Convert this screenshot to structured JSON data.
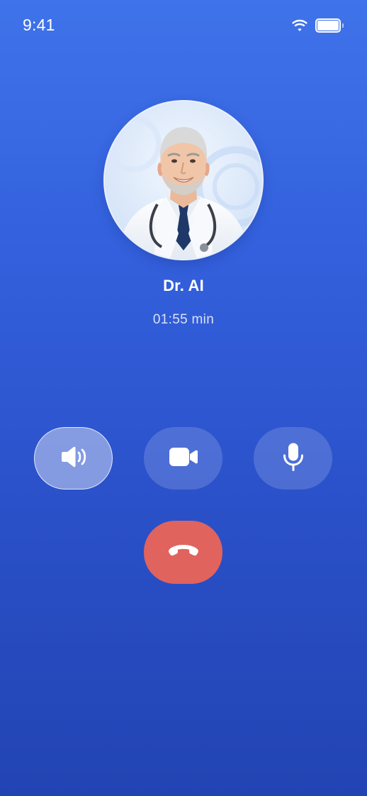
{
  "status_bar": {
    "time": "9:41",
    "wifi_icon": "wifi-icon",
    "battery_icon": "battery-icon",
    "battery_level": 1.0
  },
  "call": {
    "caller_name": "Dr. AI",
    "duration": "01:55 min",
    "avatar_icon": "doctor-avatar"
  },
  "controls": [
    {
      "name": "speaker",
      "icon": "speaker-icon",
      "active": true
    },
    {
      "name": "video",
      "icon": "video-camera-icon",
      "active": false
    },
    {
      "name": "microphone",
      "icon": "microphone-icon",
      "active": false
    }
  ],
  "end_call": {
    "icon": "hang-up-icon",
    "color": "#E0635E"
  },
  "colors": {
    "background_top": "#3F73EA",
    "background_bottom": "#2244B3",
    "end_call": "#E0635E",
    "text": "#FFFFFF"
  }
}
